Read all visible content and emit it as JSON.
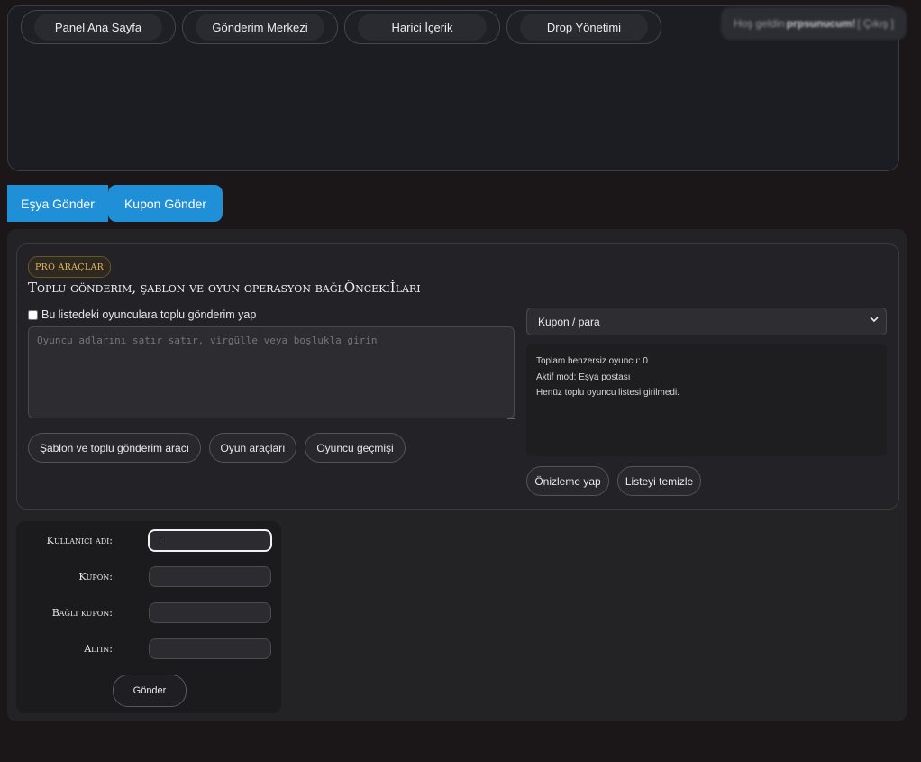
{
  "nav": {
    "items": [
      {
        "label": "Panel Ana Sayfa"
      },
      {
        "label": "Gönderim Merkezi"
      },
      {
        "label": "Harici İçerik"
      },
      {
        "label": "Drop Yönetimi"
      }
    ],
    "welcome_prefix": "Hoş geldin",
    "welcome_user": "prpsunucum!",
    "logout": "[ Çıkış ]"
  },
  "tabs": [
    {
      "label": "Eşya Gönder"
    },
    {
      "label": "Kupon Gönder"
    }
  ],
  "pro_tools": {
    "badge": "PRO ARAÇLAR",
    "title": "Toplu gönderim, şablon ve oyun operasyon bağlÖncekiİları",
    "checkbox_label": "Bu listedeki oyunculara toplu gönderim yap",
    "players_placeholder": "Oyuncu adlarını satır satır, virgülle veya boşlukla girin",
    "buttons": [
      {
        "label": "Şablon ve toplu gönderim aracı"
      },
      {
        "label": "Oyun araçları"
      },
      {
        "label": "Oyuncu geçmişi"
      }
    ],
    "mode_select": {
      "selected": "Kupon / para"
    },
    "summary_lines": [
      "Toplam benzersiz oyuncu: 0",
      "Aktif mod: Eşya postası",
      "Henüz toplu oyuncu listesi girilmedi."
    ],
    "preview_button": "Önizleme yap",
    "clear_button": "Listeyi temizle"
  },
  "form": {
    "username_label": "Kullanıcı adı:",
    "coupon_label": "Kupon:",
    "bound_coupon_label": "Bağlı kupon:",
    "gold_label": "Altın:",
    "submit_label": "Gönder"
  },
  "colors": {
    "accent": "#1f8fd8",
    "badge_gold": "#e3b659",
    "background": "#1b1719"
  }
}
